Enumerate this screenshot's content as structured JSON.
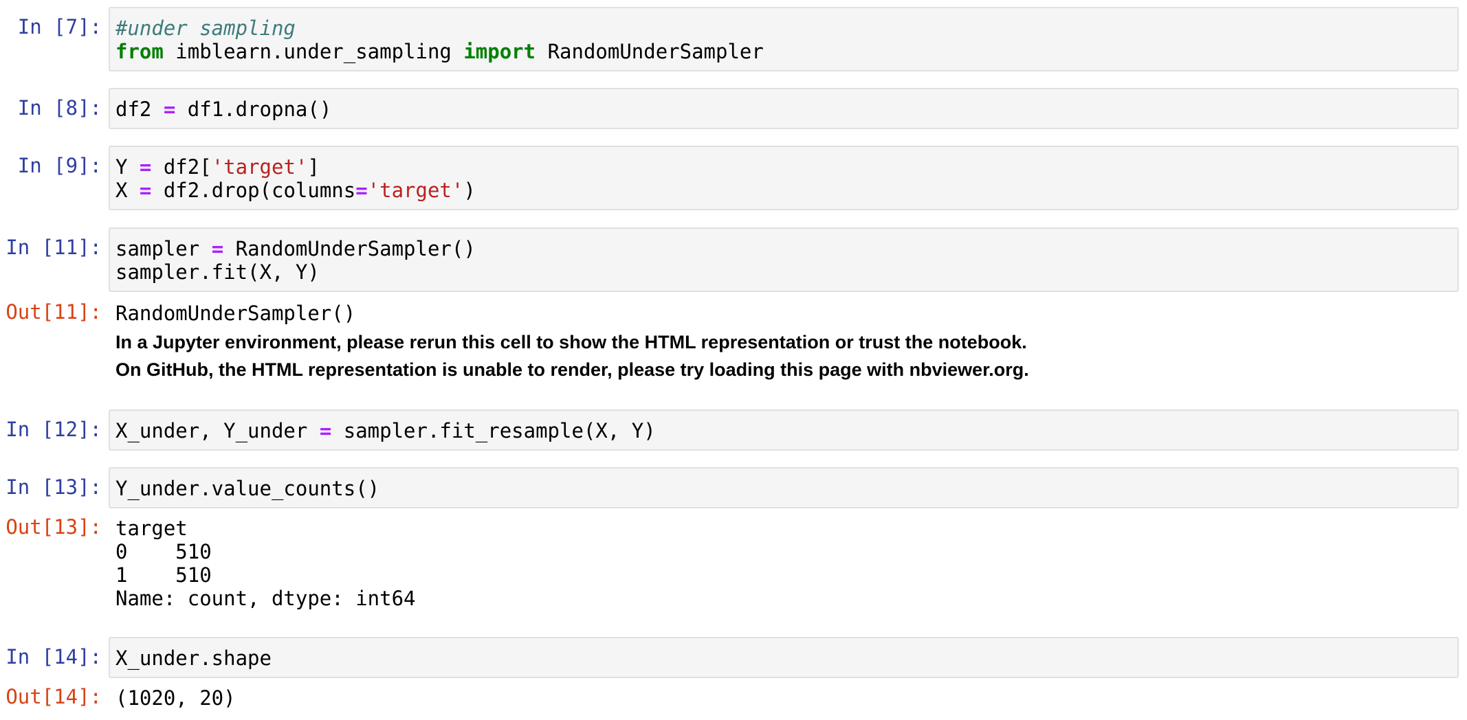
{
  "cells": [
    {
      "prompt": "In [7]:",
      "code": [
        [
          {
            "t": "#under sampling",
            "c": "cm"
          }
        ],
        [
          {
            "t": "from",
            "c": "kw"
          },
          {
            "t": " imblearn.under_sampling ",
            "c": ""
          },
          {
            "t": "import",
            "c": "kw"
          },
          {
            "t": " RandomUnderSampler",
            "c": ""
          }
        ]
      ]
    },
    {
      "prompt": "In [8]:",
      "code": [
        [
          {
            "t": "df2 ",
            "c": ""
          },
          {
            "t": "=",
            "c": "op"
          },
          {
            "t": " df1.dropna()",
            "c": ""
          }
        ]
      ]
    },
    {
      "prompt": "In [9]:",
      "code": [
        [
          {
            "t": "Y ",
            "c": ""
          },
          {
            "t": "=",
            "c": "op"
          },
          {
            "t": " df2[",
            "c": ""
          },
          {
            "t": "'target'",
            "c": "st"
          },
          {
            "t": "]",
            "c": ""
          }
        ],
        [
          {
            "t": "X ",
            "c": ""
          },
          {
            "t": "=",
            "c": "op"
          },
          {
            "t": " df2.drop(columns",
            "c": ""
          },
          {
            "t": "=",
            "c": "op"
          },
          {
            "t": "'target'",
            "c": "st"
          },
          {
            "t": ")",
            "c": ""
          }
        ]
      ]
    },
    {
      "prompt": "In [11]:",
      "code": [
        [
          {
            "t": "sampler ",
            "c": ""
          },
          {
            "t": "=",
            "c": "op"
          },
          {
            "t": " RandomUnderSampler()",
            "c": ""
          }
        ],
        [
          {
            "t": "sampler.fit(X, Y)",
            "c": ""
          }
        ]
      ],
      "out_prompt": "Out[11]:",
      "output_mono": [
        "RandomUnderSampler()"
      ],
      "output_text": [
        "In a Jupyter environment, please rerun this cell to show the HTML representation or trust the notebook.",
        "On GitHub, the HTML representation is unable to render, please try loading this page with nbviewer.org."
      ]
    },
    {
      "prompt": "In [12]:",
      "code": [
        [
          {
            "t": "X_under, Y_under ",
            "c": ""
          },
          {
            "t": "=",
            "c": "op"
          },
          {
            "t": " sampler.fit_resample(X, Y)",
            "c": ""
          }
        ]
      ]
    },
    {
      "prompt": "In [13]:",
      "code": [
        [
          {
            "t": "Y_under.value_counts()",
            "c": ""
          }
        ]
      ],
      "out_prompt": "Out[13]:",
      "output_mono": [
        "target",
        "0    510",
        "1    510",
        "Name: count, dtype: int64"
      ]
    },
    {
      "prompt": "In [14]:",
      "code": [
        [
          {
            "t": "X_under.shape",
            "c": ""
          }
        ]
      ],
      "out_prompt": "Out[14]:",
      "output_mono": [
        "(1020, 20)"
      ]
    }
  ]
}
